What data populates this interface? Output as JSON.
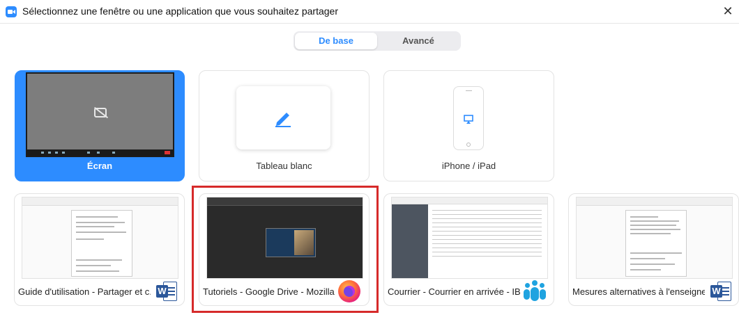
{
  "window": {
    "title": "Sélectionnez une fenêtre ou une application que vous souhaitez partager",
    "close_glyph": "✕"
  },
  "tabs": [
    {
      "label": "De base",
      "selected": true
    },
    {
      "label": "Avancé",
      "selected": false
    }
  ],
  "share_options": [
    {
      "label": "Écran",
      "icon": "camera-off-icon",
      "selected": true
    },
    {
      "label": "Tableau blanc",
      "icon": "pen-icon",
      "selected": false
    },
    {
      "label": "iPhone / iPad",
      "icon": "airplay-icon",
      "selected": false
    }
  ],
  "windows": [
    {
      "label": "Guide d'utilisation - Partager et c...",
      "app_icon": "word-icon",
      "app_letter": "W"
    },
    {
      "label": "Tutoriels - Google Drive - Mozilla ...",
      "app_icon": "firefox-icon"
    },
    {
      "label": "Courrier - Courrier en arrivée - IB...",
      "app_icon": "ibm-notes-icon"
    },
    {
      "label": "Mesures alternatives à l'enseigne...",
      "app_icon": "word-icon",
      "app_letter": "W"
    }
  ],
  "colors": {
    "accent": "#2d8cff",
    "highlight_border": "#d62a2a",
    "word_blue": "#2b579a"
  }
}
